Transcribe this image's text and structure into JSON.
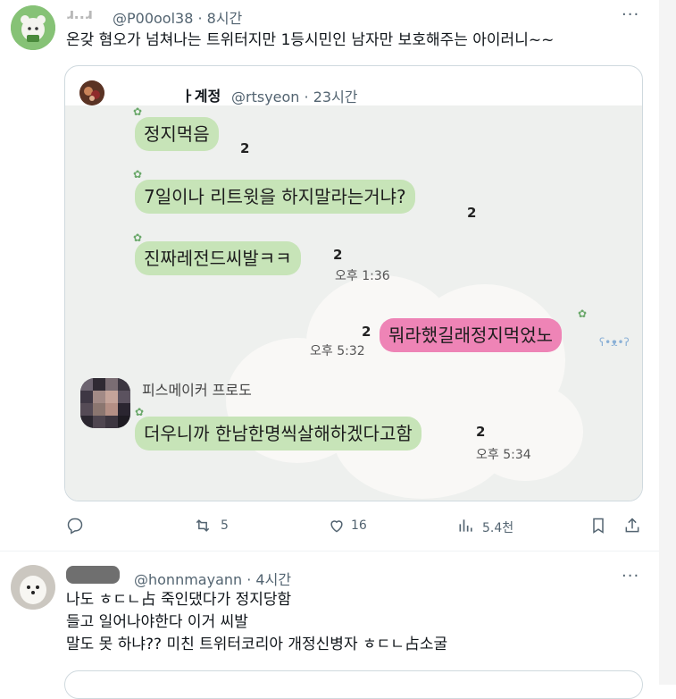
{
  "tweet1": {
    "name": "ɹ..ɹ",
    "handle": "@P00ool38",
    "time": "8시간",
    "text": "온갖 혐오가 넘쳐나는 트위터지만 1등시민인 남자만 보호해주는 아이러니~~",
    "more": "···"
  },
  "quote": {
    "name": "ㅏ계정",
    "handle": "@rtsyeon",
    "time": "23시간",
    "chat": {
      "m1": "정지먹음",
      "m1_count": "2",
      "m2": "7일이나 리트윗을 하지말라는거냐?",
      "m2_count": "2",
      "m3": "진짜레전드씨발ㅋㅋ",
      "m3_count": "2",
      "m3_time": "오후 1:36",
      "m4": "뭐라했길래정지먹었노",
      "m4_count": "2",
      "m4_time": "오후 5:32",
      "sender": "피스메이커 프로도",
      "m5": "더우니까 한남한명씩살해하겠다고함",
      "m5_count": "2",
      "m5_time": "오후 5:34"
    }
  },
  "actions": {
    "retweets": "5",
    "likes": "16",
    "views": "5.4천"
  },
  "tweet2": {
    "name": "",
    "handle": "@honnmayann",
    "time": "4시간",
    "line1": "나도 ㅎㄷㄴ占 죽인댔다가 정지당함",
    "line2": "들고 일어나야한다 이거 씨발",
    "line3": "말도 못 하냐?? 미친 트위터코리아 개정신병자 ㅎㄷㄴ占소굴",
    "more": "···"
  }
}
